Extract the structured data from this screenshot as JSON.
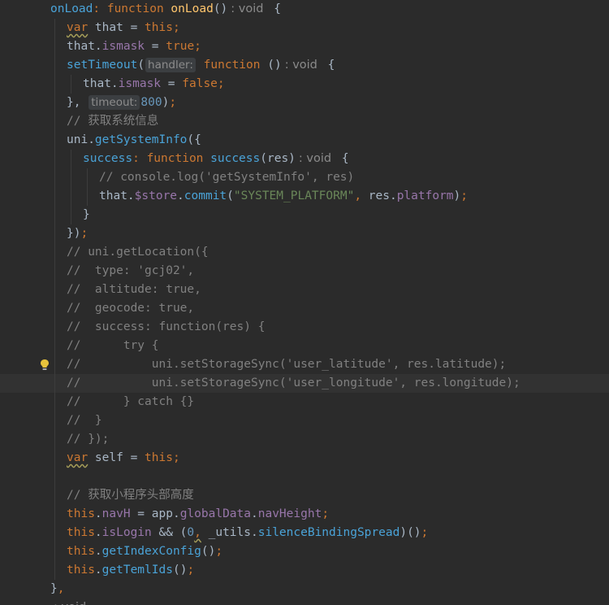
{
  "editor": {
    "lines": [
      {
        "indent": 0,
        "spans": [
          [
            "fn2",
            "onLoad"
          ],
          [
            "kw",
            ": function "
          ],
          [
            "fn",
            "onLoad"
          ],
          [
            "txt",
            "()"
          ],
          [
            "rtype",
            ": void"
          ],
          [
            "txt",
            " {"
          ]
        ]
      },
      {
        "indent": 1,
        "spans": [
          [
            "kw_wavy",
            "var"
          ],
          [
            "txt",
            " that = "
          ],
          [
            "kw",
            "this"
          ],
          [
            "kw",
            ";"
          ]
        ]
      },
      {
        "indent": 1,
        "spans": [
          [
            "txt",
            "that."
          ],
          [
            "prop",
            "ismask"
          ],
          [
            "txt",
            " = "
          ],
          [
            "kw",
            "true"
          ],
          [
            "kw",
            ";"
          ]
        ]
      },
      {
        "indent": 1,
        "spans": [
          [
            "fn2",
            "setTimeout"
          ],
          [
            "txt",
            "("
          ],
          [
            "hint",
            "handler:"
          ],
          [
            "kw",
            " function "
          ],
          [
            "txt",
            "()"
          ],
          [
            "rtype",
            ": void"
          ],
          [
            "txt",
            " {"
          ]
        ]
      },
      {
        "indent": 2,
        "spans": [
          [
            "txt",
            "that."
          ],
          [
            "prop",
            "ismask"
          ],
          [
            "txt",
            " = "
          ],
          [
            "kw",
            "false"
          ],
          [
            "kw",
            ";"
          ]
        ]
      },
      {
        "indent": 1,
        "spans": [
          [
            "txt",
            "}, "
          ],
          [
            "hint",
            "timeout:"
          ],
          [
            "num",
            "800"
          ],
          [
            "txt",
            ")"
          ],
          [
            "kw",
            ";"
          ]
        ]
      },
      {
        "indent": 1,
        "spans": [
          [
            "cm",
            "// 获取系统信息"
          ]
        ]
      },
      {
        "indent": 1,
        "spans": [
          [
            "txt",
            "uni."
          ],
          [
            "fn2",
            "getSystemInfo"
          ],
          [
            "txt",
            "({"
          ]
        ]
      },
      {
        "indent": 2,
        "spans": [
          [
            "fn2",
            "success"
          ],
          [
            "kw",
            ": function "
          ],
          [
            "fn2",
            "success"
          ],
          [
            "txt",
            "(res)"
          ],
          [
            "rtype",
            ": void"
          ],
          [
            "txt",
            " {"
          ]
        ]
      },
      {
        "indent": 3,
        "spans": [
          [
            "cm",
            "// console.log('getSystemInfo', res)"
          ]
        ]
      },
      {
        "indent": 3,
        "spans": [
          [
            "txt",
            "that."
          ],
          [
            "prop",
            "$store"
          ],
          [
            "txt",
            "."
          ],
          [
            "fn2",
            "commit"
          ],
          [
            "txt",
            "("
          ],
          [
            "str",
            "\"SYSTEM_PLATFORM\""
          ],
          [
            "kw",
            ", "
          ],
          [
            "txt",
            "res."
          ],
          [
            "prop",
            "platform"
          ],
          [
            "txt",
            ")"
          ],
          [
            "kw",
            ";"
          ]
        ]
      },
      {
        "indent": 2,
        "spans": [
          [
            "txt",
            "}"
          ]
        ]
      },
      {
        "indent": 1,
        "spans": [
          [
            "txt",
            "})"
          ],
          [
            "kw",
            ";"
          ]
        ]
      },
      {
        "indent": 1,
        "spans": [
          [
            "cm",
            "// uni.getLocation({"
          ]
        ]
      },
      {
        "indent": 1,
        "spans": [
          [
            "cm",
            "//  type: 'gcj02',"
          ]
        ]
      },
      {
        "indent": 1,
        "spans": [
          [
            "cm",
            "//  altitude: true,"
          ]
        ]
      },
      {
        "indent": 1,
        "spans": [
          [
            "cm",
            "//  geocode: true,"
          ]
        ]
      },
      {
        "indent": 1,
        "spans": [
          [
            "cm",
            "//  success: function(res) {"
          ]
        ]
      },
      {
        "indent": 1,
        "spans": [
          [
            "cm",
            "//      try {"
          ]
        ]
      },
      {
        "indent": 1,
        "spans": [
          [
            "cm",
            "//          uni.setStorageSync('user_latitude', res.latitude);"
          ]
        ]
      },
      {
        "indent": 1,
        "spans": [
          [
            "cm",
            "//          uni.setStorageSync('user_longitude', res.longitude);"
          ]
        ]
      },
      {
        "indent": 1,
        "spans": [
          [
            "cm",
            "//      } catch {}"
          ]
        ]
      },
      {
        "indent": 1,
        "spans": [
          [
            "cm",
            "//  }"
          ]
        ]
      },
      {
        "indent": 1,
        "spans": [
          [
            "cm",
            "// });"
          ]
        ]
      },
      {
        "indent": 1,
        "spans": [
          [
            "kw_wavy",
            "var"
          ],
          [
            "txt",
            " self = "
          ],
          [
            "kw",
            "this"
          ],
          [
            "kw",
            ";"
          ]
        ]
      },
      {
        "indent": 1,
        "spans": []
      },
      {
        "indent": 1,
        "spans": [
          [
            "cm",
            "// 获取小程序头部高度"
          ]
        ]
      },
      {
        "indent": 1,
        "spans": [
          [
            "kw",
            "this"
          ],
          [
            "txt",
            "."
          ],
          [
            "prop",
            "navH"
          ],
          [
            "txt",
            " = app."
          ],
          [
            "prop",
            "globalData"
          ],
          [
            "txt",
            "."
          ],
          [
            "prop",
            "navHeight"
          ],
          [
            "kw",
            ";"
          ]
        ]
      },
      {
        "indent": 1,
        "spans": [
          [
            "kw",
            "this"
          ],
          [
            "txt",
            "."
          ],
          [
            "prop",
            "isLogin"
          ],
          [
            "txt",
            " && ("
          ],
          [
            "num",
            "0"
          ],
          [
            "kw_wavy",
            ","
          ],
          [
            "txt",
            " _utils."
          ],
          [
            "fn2",
            "silenceBindingSpread"
          ],
          [
            "txt",
            ")()"
          ],
          [
            "kw",
            ";"
          ]
        ]
      },
      {
        "indent": 1,
        "spans": [
          [
            "kw",
            "this"
          ],
          [
            "txt",
            "."
          ],
          [
            "fn2",
            "getIndexConfig"
          ],
          [
            "txt",
            "()"
          ],
          [
            "kw",
            ";"
          ]
        ]
      },
      {
        "indent": 1,
        "spans": [
          [
            "kw",
            "this"
          ],
          [
            "txt",
            "."
          ],
          [
            "fn2",
            "getTemlIds"
          ],
          [
            "txt",
            "()"
          ],
          [
            "kw",
            ";"
          ]
        ]
      },
      {
        "indent": 0,
        "spans": [
          [
            "txt",
            "}"
          ],
          [
            "kw",
            ","
          ]
        ]
      },
      {
        "indent": 0,
        "spans": [
          [
            "rtype",
            ": void"
          ]
        ]
      }
    ],
    "current_line": 20,
    "intention_bulb_line": 19
  },
  "colors": {
    "background": "#2b2b2b",
    "current_line": "#323232",
    "keyword": "#cc7832",
    "function": "#4aa3d8",
    "property": "#9876aa",
    "string": "#6a8759",
    "number": "#6897bb",
    "comment": "#808080",
    "text": "#a9b7c6",
    "bulb": "#e8c33c"
  }
}
